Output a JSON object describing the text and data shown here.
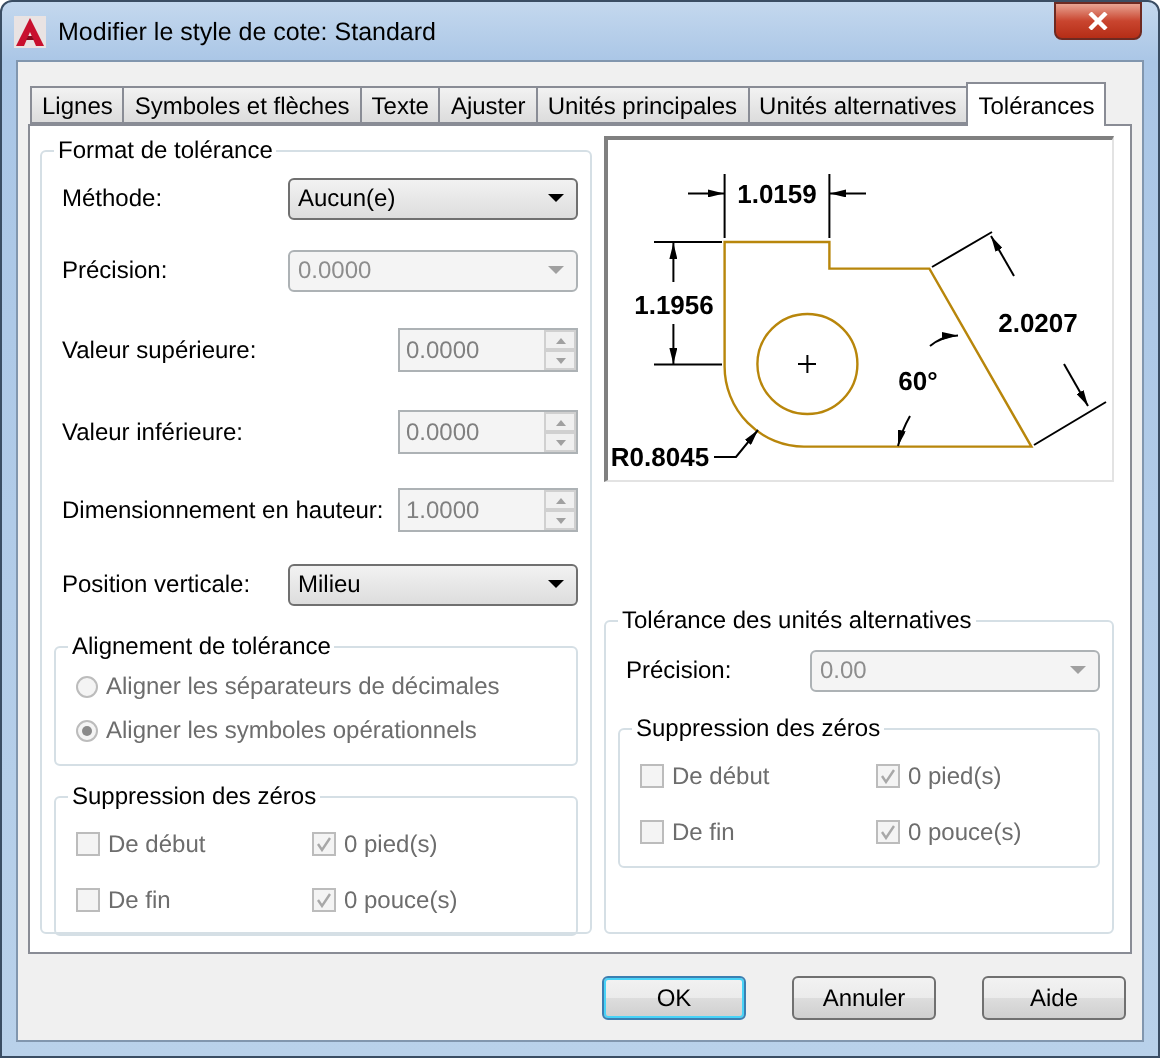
{
  "window": {
    "title": "Modifier le style de cote: Standard"
  },
  "tabs": [
    {
      "label": "Lignes",
      "selected": false
    },
    {
      "label": "Symboles et flèches",
      "selected": false
    },
    {
      "label": "Texte",
      "selected": false
    },
    {
      "label": "Ajuster",
      "selected": false
    },
    {
      "label": "Unités principales",
      "selected": false
    },
    {
      "label": "Unités alternatives",
      "selected": false
    },
    {
      "label": "Tolérances",
      "selected": true
    }
  ],
  "tolerance_format": {
    "title": "Format de tolérance",
    "fields": [
      {
        "kind": "dropdown",
        "label": "Méthode:",
        "value": "Aucun(e)",
        "disabled": false
      },
      {
        "kind": "dropdown",
        "label": "Précision:",
        "value": "0.0000",
        "disabled": true
      },
      {
        "kind": "spinner",
        "label": "Valeur supérieure:",
        "value": "0.0000",
        "disabled": true
      },
      {
        "kind": "spinner",
        "label": "Valeur inférieure:",
        "value": "0.0000",
        "disabled": true
      },
      {
        "kind": "spinner",
        "label": "Dimensionnement en hauteur:",
        "value": "1.0000",
        "disabled": true
      },
      {
        "kind": "dropdown",
        "label": "Position verticale:",
        "value": "Milieu",
        "disabled": false
      }
    ],
    "alignment": {
      "title": "Alignement de tolérance",
      "options": [
        {
          "label": "Aligner les séparateurs de décimales",
          "selected": false,
          "disabled": true
        },
        {
          "label": "Aligner les symboles opérationnels",
          "selected": true,
          "disabled": true
        }
      ]
    },
    "zero_suppression": {
      "title": "Suppression des zéros",
      "options": [
        {
          "label": "De début",
          "checked": false,
          "disabled": true
        },
        {
          "label": "0 pied(s)",
          "checked": true,
          "disabled": true
        },
        {
          "label": "De fin",
          "checked": false,
          "disabled": true
        },
        {
          "label": "0 pouce(s)",
          "checked": true,
          "disabled": true
        }
      ]
    }
  },
  "preview": {
    "labels": [
      "1.0159",
      "1.1956",
      "2.0207",
      "60°",
      "R0.8045"
    ]
  },
  "alt_units": {
    "title": "Tolérance des unités alternatives",
    "precision": {
      "label": "Précision:",
      "value": "0.00",
      "disabled": true
    },
    "zero_suppression": {
      "title": "Suppression des zéros",
      "options": [
        {
          "label": "De début",
          "checked": false,
          "disabled": true
        },
        {
          "label": "0 pied(s)",
          "checked": true,
          "disabled": true
        },
        {
          "label": "De fin",
          "checked": false,
          "disabled": true
        },
        {
          "label": "0 pouce(s)",
          "checked": true,
          "disabled": true
        }
      ]
    }
  },
  "buttons": [
    {
      "label": "OK",
      "default": true
    },
    {
      "label": "Annuler",
      "default": false
    },
    {
      "label": "Aide",
      "default": false
    }
  ]
}
